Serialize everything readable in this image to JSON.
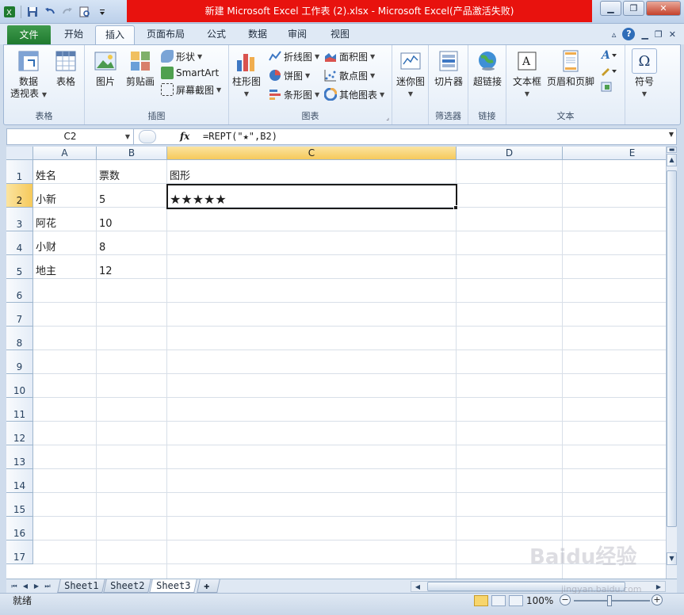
{
  "window": {
    "title": "新建 Microsoft Excel 工作表 (2).xlsx - Microsoft Excel(产品激活失败)"
  },
  "ribbon": {
    "tabs": [
      "文件",
      "开始",
      "插入",
      "页面布局",
      "公式",
      "数据",
      "审阅",
      "视图"
    ],
    "active_tab": "插入",
    "groups": {
      "tables": {
        "name": "表格",
        "pivot": "数据\n透视表",
        "pivot_l1": "数据",
        "pivot_l2": "透视表",
        "table": "表格"
      },
      "illustrations": {
        "name": "插图",
        "picture": "图片",
        "clipart": "剪贴画",
        "shapes": "形状",
        "smartart": "SmartArt",
        "screenshot": "屏幕截图"
      },
      "charts": {
        "name": "图表",
        "column": "柱形图",
        "line": "折线图",
        "pie": "饼图",
        "bar": "条形图",
        "area": "面积图",
        "scatter": "散点图",
        "other": "其他图表"
      },
      "sparklines": {
        "name": "",
        "sparkline": "迷你图"
      },
      "filter": {
        "name": "筛选器",
        "slicer": "切片器"
      },
      "links": {
        "name": "链接",
        "hyperlink": "超链接"
      },
      "text": {
        "name": "文本",
        "textbox": "文本框",
        "headerfooter": "页眉和页脚"
      },
      "symbols": {
        "symbol": "符号"
      }
    }
  },
  "formula_bar": {
    "name_box": "C2",
    "fx": "fx",
    "formula": "=REPT(\"★\",B2)"
  },
  "grid": {
    "columns": [
      "A",
      "B",
      "C",
      "D",
      "E"
    ],
    "selected_column": "C",
    "rows": [
      "1",
      "2",
      "3",
      "4",
      "5",
      "6",
      "7",
      "8",
      "9",
      "10",
      "11",
      "12",
      "13",
      "14",
      "15",
      "16",
      "17"
    ],
    "selected_row": "2",
    "cells": {
      "A1": "姓名",
      "B1": "票数",
      "C1": "图形",
      "A2": "小新",
      "B2": "5",
      "C2": "★★★★★",
      "A3": "阿花",
      "B3": "10",
      "A4": "小财",
      "B4": "8",
      "A5": "地主",
      "B5": "12"
    }
  },
  "sheet_tabs": [
    "Sheet1",
    "Sheet2",
    "Sheet3"
  ],
  "active_sheet": "Sheet3",
  "status": {
    "ready": "就绪",
    "zoom": "100%"
  },
  "watermark": {
    "brand": "Baidu经验",
    "url": "jingyan.baidu.com"
  },
  "colors": {
    "title_bar": "#e8120e",
    "file_tab": "#1f7a2f",
    "selection_header": "#f6c95b"
  }
}
